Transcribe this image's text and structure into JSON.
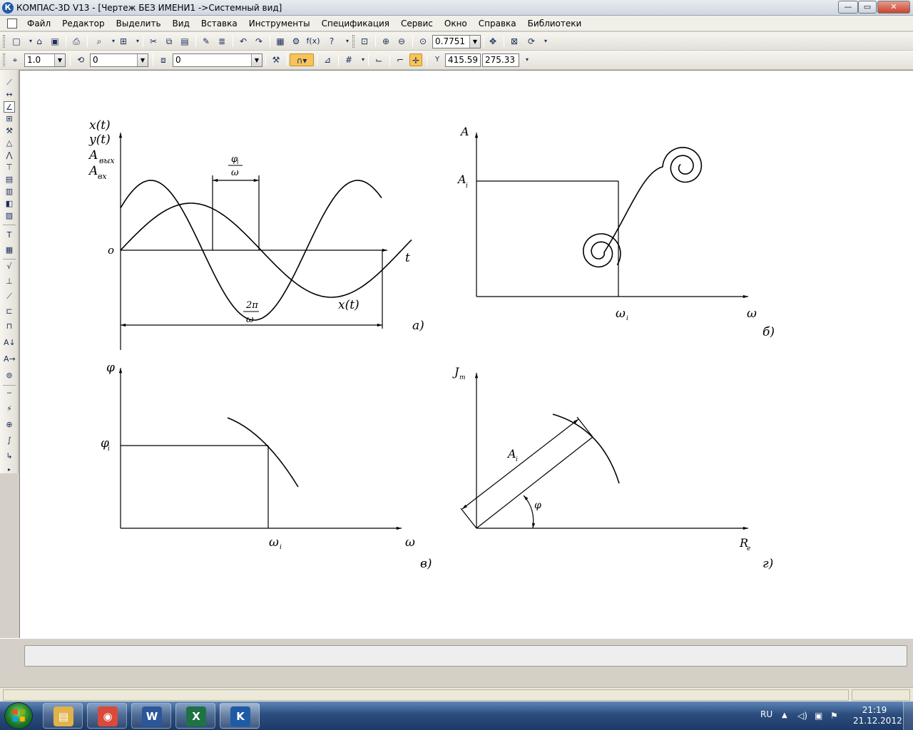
{
  "window": {
    "title": "КОМПАС-3D V13 - [Чертеж БЕЗ ИМЕНИ1 ->Системный вид]",
    "app_icon": "К",
    "minimize": "—",
    "restore": "▭",
    "close": "✕"
  },
  "menu": {
    "items": [
      "Файл",
      "Редактор",
      "Выделить",
      "Вид",
      "Вставка",
      "Инструменты",
      "Спецификация",
      "Сервис",
      "Окно",
      "Справка",
      "Библиотеки"
    ],
    "mdi_controls": [
      "–",
      "▫",
      "×"
    ]
  },
  "toolbar1": {
    "zoom_value": "0.7751"
  },
  "toolbar2": {
    "line_scale": "1.0",
    "layer_combo": "0",
    "style_combo": "0",
    "coord_x": "415.59",
    "coord_y": "275.33"
  },
  "drawing": {
    "fig_a": {
      "y_labels": [
        "x(t)",
        "y(t)",
        "A",
        "вых",
        "A",
        "вх"
      ],
      "origin": "o",
      "t_axis": "t",
      "phase_num": "φ",
      "phase_sub": "i",
      "phase_den": "ω",
      "period_num": "2π",
      "period_den": "ω",
      "curve_label": "x(t)",
      "caption": "а)"
    },
    "fig_b": {
      "y_axis": "A",
      "level": "A",
      "level_sub": "i",
      "x_axis": "ω",
      "x_mark": "ω",
      "x_mark_sub": "i",
      "caption": "б)"
    },
    "fig_c": {
      "y_axis": "φ",
      "level": "φ",
      "level_sub": "i",
      "x_mark": "ω",
      "x_mark_sub": "i",
      "x_axis": "ω",
      "caption": "в)"
    },
    "fig_d": {
      "y_axis": "J",
      "y_axis_sub": "m",
      "x_axis": "R",
      "x_axis_sub": "e",
      "vector_label": "A",
      "vector_sub": "i",
      "angle_label": "φ",
      "caption": "г)"
    }
  },
  "taskbar": {
    "apps": [
      {
        "name": "explorer",
        "glyph": "▤",
        "color": "#e0b24a"
      },
      {
        "name": "chrome",
        "glyph": "◉",
        "color": "#d94a3a"
      },
      {
        "name": "word",
        "glyph": "W",
        "color": "#2b579a"
      },
      {
        "name": "excel",
        "glyph": "X",
        "color": "#1f7244"
      },
      {
        "name": "kompas",
        "glyph": "K",
        "color": "#1f5aa6"
      }
    ],
    "lang": "RU",
    "time": "21:19",
    "date": "21.12.2012"
  }
}
